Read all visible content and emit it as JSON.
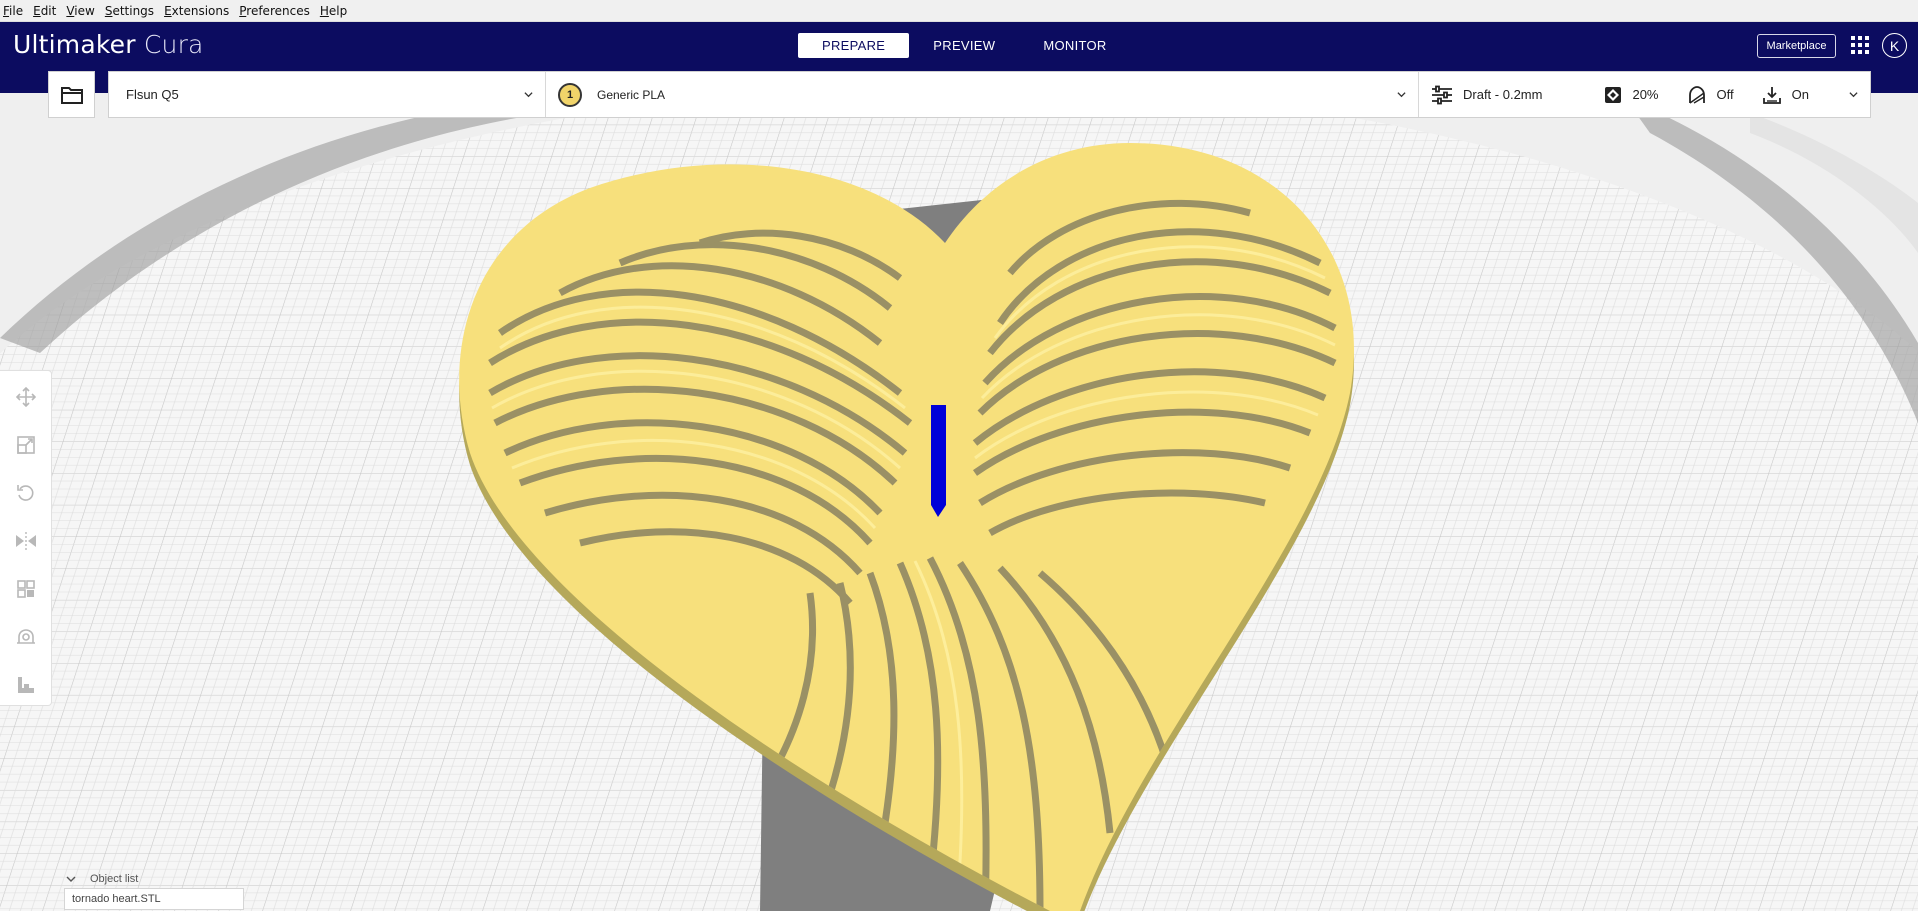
{
  "menu": {
    "items": [
      {
        "first": "F",
        "rest": "ile"
      },
      {
        "first": "E",
        "rest": "dit"
      },
      {
        "first": "V",
        "rest": "iew"
      },
      {
        "first": "S",
        "rest": "ettings"
      },
      {
        "first": "E",
        "rest": "xtensions"
      },
      {
        "first": "P",
        "rest": "references"
      },
      {
        "first": "H",
        "rest": "elp"
      }
    ]
  },
  "header": {
    "brand_bold": "Ultimaker",
    "brand_light": "Cura",
    "tabs": [
      {
        "label": "PREPARE",
        "active": true
      },
      {
        "label": "PREVIEW",
        "active": false
      },
      {
        "label": "MONITOR",
        "active": false
      }
    ],
    "marketplace_label": "Marketplace",
    "account_initial": "K"
  },
  "printer": {
    "name": "Flsun Q5"
  },
  "material": {
    "extruder_number": "1",
    "name": "Generic PLA",
    "color": "#f1d46a"
  },
  "print_settings": {
    "profile": "Draft - 0.2mm",
    "infill": "20%",
    "support": "Off",
    "adhesion": "On"
  },
  "tools": [
    {
      "name": "move-tool-icon"
    },
    {
      "name": "scale-tool-icon"
    },
    {
      "name": "rotate-tool-icon"
    },
    {
      "name": "mirror-tool-icon"
    },
    {
      "name": "per-model-settings-icon"
    },
    {
      "name": "support-blocker-icon"
    },
    {
      "name": "lay-flat-icon"
    }
  ],
  "object_list": {
    "title": "Object list",
    "items": [
      "tornado heart.STL"
    ]
  },
  "colors": {
    "header_bg": "#0c0c60",
    "model_yellow": "#f7e07c",
    "model_shadow": "#8a8a8a",
    "buildplate": "#f4f4f4",
    "grid": "#c9c9c9",
    "selection_axis": "#0000d8"
  }
}
